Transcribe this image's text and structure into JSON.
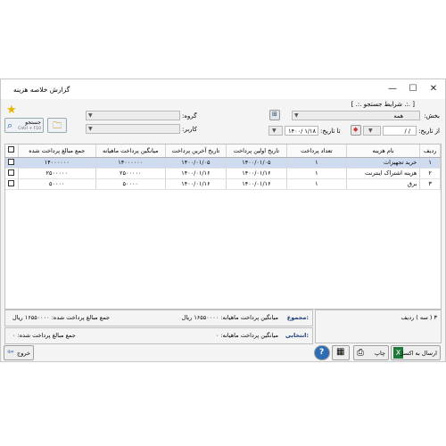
{
  "window": {
    "title": "گزارش خلاصه هزینه",
    "minimize": "—",
    "maximize": "☐",
    "close": "✕"
  },
  "search_panel": {
    "header": "[ .:. شرایط جستجو .:. ]",
    "section_label": "بخش:",
    "section_value": "همه",
    "group_label": "گروه:",
    "user_label": "کاربر:",
    "from_date_label": "از تاریخ:",
    "from_date_value": "/   /",
    "to_date_label": "تا تاریخ:",
    "to_date_value": "۱۴۰۰/ ۱/۱۸",
    "search_button_label": "جستجو",
    "search_button_hint": "Cntrl + F10"
  },
  "table": {
    "columns": [
      "ردیف",
      "نام هزینه",
      "تعداد پرداخت",
      "تاریخ اولین پرداخت",
      "تاریخ آخرین پرداخت",
      "میانگین پرداخت ماهیانه",
      "جمع مبالغ پرداخت شده"
    ],
    "rows": [
      [
        "۱",
        "خرید تجهیزات",
        "۱",
        "۱۴۰۰/۰۱/۰۵",
        "۱۴۰۰/۰۱/۰۵",
        "۱۴۰۰۰۰۰۰",
        "۱۴۰۰۰۰۰۰"
      ],
      [
        "۲",
        "هزینه اشتراک اینترنت",
        "۱",
        "۱۴۰۰/۰۱/۱۶",
        "۱۴۰۰/۰۱/۱۶",
        "۲۵۰۰۰۰۰",
        "۲۵۰۰۰۰۰"
      ],
      [
        "۳",
        "برق",
        "۱",
        "۱۴۰۰/۰۱/۱۶",
        "۱۴۰۰/۰۱/۱۶",
        "۵۰۰۰۰",
        "۵۰۰۰۰"
      ]
    ]
  },
  "footer": {
    "record_count": "۳ ( سه ) ردیف",
    "total_label": "مجموع:",
    "total_avg": "میانگین پرداخت ماهیانه: ۱۶۵۵۰۰۰۰ ریال",
    "total_sum": "جمع مبالغ پرداخت شده: ۱۶۵۵۰۰۰۰ ریال",
    "selected_label": "انتخابی:",
    "selected_avg": "میانگین پرداخت ماهیانه: ۰",
    "selected_sum": "جمع مبالغ پرداخت شده: ۰"
  },
  "buttons": {
    "excel": "ارسال به اکسل",
    "print": "چاپ",
    "exit": "خروج"
  },
  "colors": {
    "selected_row": "#cfdcf0",
    "accent": "#2e6db4"
  }
}
